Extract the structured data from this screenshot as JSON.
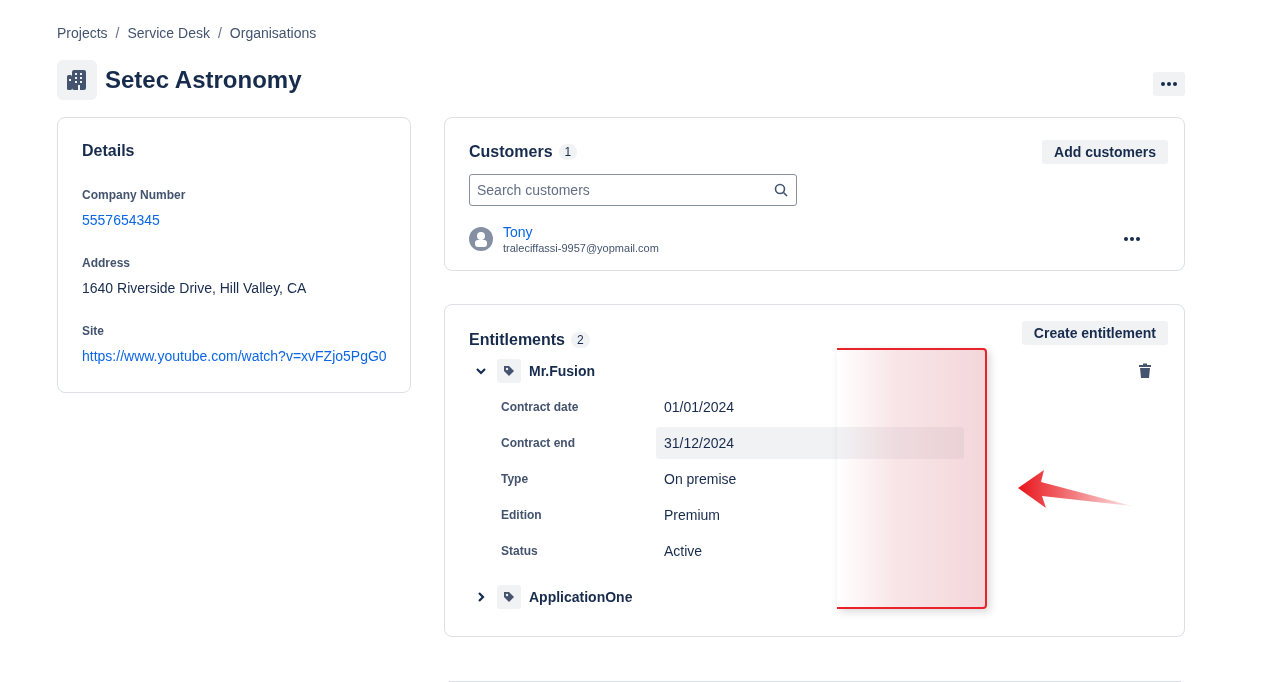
{
  "breadcrumbs": {
    "separator": "/",
    "items": [
      "Projects",
      "Service Desk",
      "Organisations"
    ]
  },
  "title": "Setec Astronomy",
  "details": {
    "heading": "Details",
    "fields": [
      {
        "label": "Company Number",
        "value": "5557654345",
        "kind": "link"
      },
      {
        "label": "Address",
        "value": "1640 Riverside Drive, Hill Valley, CA",
        "kind": "text"
      },
      {
        "label": "Site",
        "value": "https://www.youtube.com/watch?v=xvFZjo5PgG0",
        "kind": "link"
      }
    ]
  },
  "customers": {
    "heading": "Customers",
    "count": "1",
    "button": "Add customers",
    "search": {
      "placeholder": "Search customers"
    },
    "items": [
      {
        "name": "Tony",
        "email": "traleciffassi-9957@yopmail.com"
      }
    ]
  },
  "entitlements": {
    "heading": "Entitlements",
    "count": "2",
    "button": "Create entitlement",
    "items": [
      {
        "name": "Mr.Fusion",
        "expanded": true,
        "fields": [
          {
            "label": "Contract date",
            "value": "01/01/2024",
            "highlighted": false
          },
          {
            "label": "Contract end",
            "value": "31/12/2024",
            "highlighted": true
          },
          {
            "label": "Type",
            "value": "On premise",
            "highlighted": false
          },
          {
            "label": "Edition",
            "value": "Premium",
            "highlighted": false
          },
          {
            "label": "Status",
            "value": "Active",
            "highlighted": false
          }
        ]
      },
      {
        "name": "ApplicationOne",
        "expanded": false
      }
    ]
  }
}
